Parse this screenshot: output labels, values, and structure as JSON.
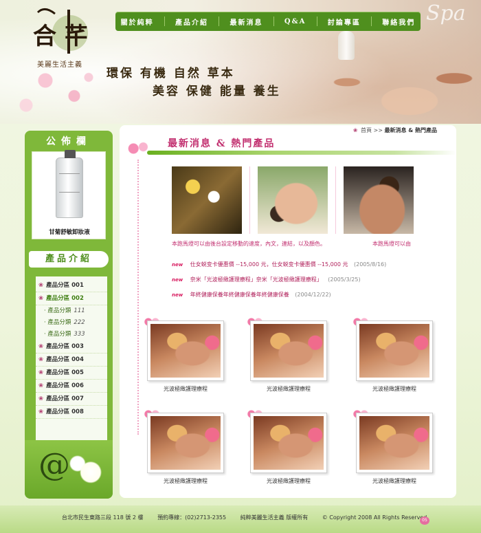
{
  "header": {
    "logo_text": "合 芊",
    "tagline": "美麗生活主義",
    "slogan_line1": "環保 有機 自然 草本",
    "slogan_line2": "美容 保健 能量 養生",
    "spa_word": "Spa"
  },
  "nav": {
    "items": [
      "關於純粹",
      "產品介紹",
      "最新消息",
      "Q&A",
      "討論專區",
      "聯絡我們"
    ]
  },
  "sidebar": {
    "bulletin_title": "公佈欄",
    "featured_product": "甘菊舒敏卸妝液",
    "product_intro_title": "產品介紹",
    "categories": [
      {
        "label": "產品分區",
        "code": "001"
      },
      {
        "label": "產品分區",
        "code": "002"
      }
    ],
    "subcategories": [
      {
        "label": "產品分類",
        "code": "111"
      },
      {
        "label": "產品分類",
        "code": "222"
      },
      {
        "label": "產品分類",
        "code": "333"
      }
    ],
    "categories_more": [
      {
        "label": "產品分區",
        "code": "003"
      },
      {
        "label": "產品分區",
        "code": "004"
      },
      {
        "label": "產品分區",
        "code": "005"
      },
      {
        "label": "產品分區",
        "code": "006"
      },
      {
        "label": "產品分區",
        "code": "007"
      },
      {
        "label": "產品分區",
        "code": "008"
      }
    ]
  },
  "breadcrumb": {
    "home": "首頁",
    "separator": ">>",
    "current": "最新消息 & 熱門產品"
  },
  "main": {
    "section_title": "最新消息 & 熱門產品",
    "feature_caption_left": "本跑馬燈可以由後台設定移動的速度，內文，連結，以及顏色。",
    "feature_caption_right": "本跑馬燈可以由",
    "news": [
      {
        "tag": "new",
        "title": "仕女蜕变卡優惠價 --15,000 元，仕女蜕变卡優惠價 --15,000 元",
        "date": "(2005/8/16)"
      },
      {
        "tag": "new",
        "title": "奈米「光波極緻護理療程」奈米「光波極緻護理療程」",
        "date": "(2005/3/25)"
      },
      {
        "tag": "new",
        "title": "年終健康保養年終健康保養年終健康保養",
        "date": "(2004/12/22)"
      }
    ],
    "products": [
      {
        "caption": "光波極緻護理療程"
      },
      {
        "caption": "光波極緻護理療程"
      },
      {
        "caption": "光波極緻護理療程"
      },
      {
        "caption": "光波極緻護理療程"
      },
      {
        "caption": "光波極緻護理療程"
      },
      {
        "caption": "光波極緻護理療程"
      }
    ]
  },
  "footer": {
    "address": "台北市民生東路三段 118 號 2 樓",
    "phone": "預約專線：(02)2713-2355",
    "company": "純粹美麗生活主義 版權所有",
    "copyright": "© Copyright 2008 All Rights Reserved.",
    "badge": "05"
  },
  "colors": {
    "brand_green": "#4f8f1e",
    "accent_pink": "#c23070",
    "sidebar_green": "#7fb83a"
  }
}
